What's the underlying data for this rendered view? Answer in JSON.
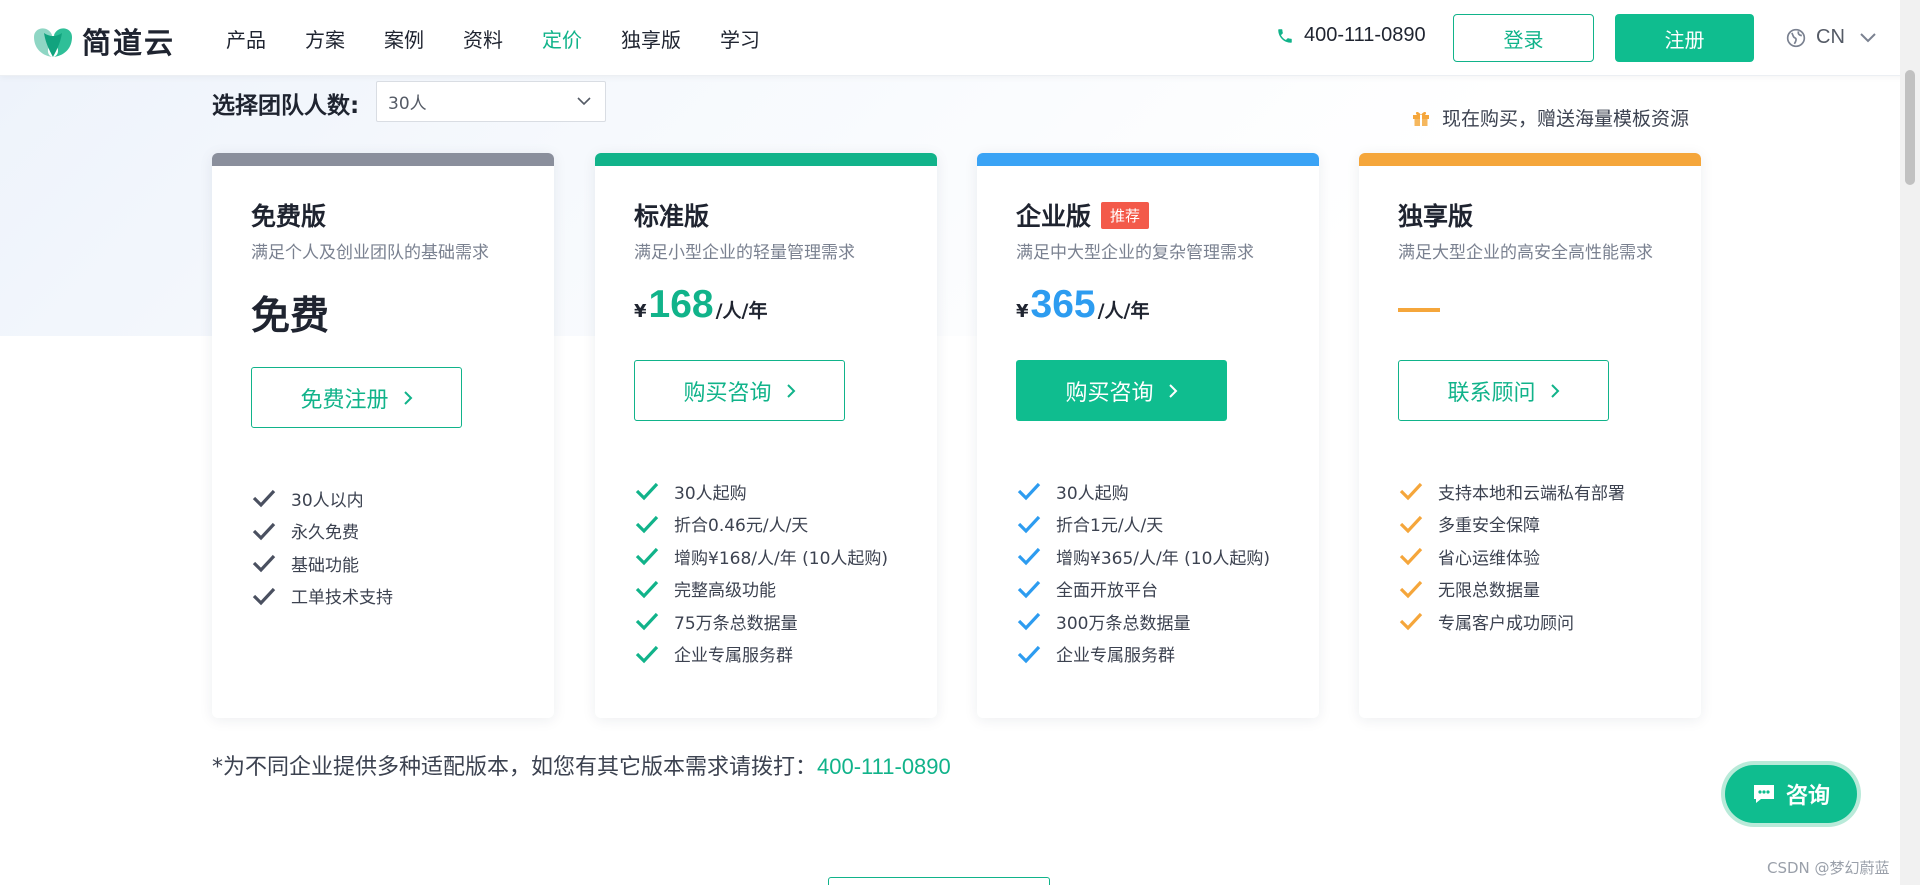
{
  "brand": {
    "name": "简道云",
    "accent": "#11b38a",
    "logo_icon": "heart-leaf-logo-icon"
  },
  "nav": {
    "items": [
      {
        "label": "产品",
        "active": false
      },
      {
        "label": "方案",
        "active": false
      },
      {
        "label": "案例",
        "active": false
      },
      {
        "label": "资料",
        "active": false
      },
      {
        "label": "定价",
        "active": true
      },
      {
        "label": "独享版",
        "active": false
      },
      {
        "label": "学习",
        "active": false
      }
    ],
    "phone": "400-111-0890",
    "login_label": "登录",
    "register_label": "注册",
    "lang": "CN"
  },
  "team": {
    "label": "选择团队人数:",
    "selected": "30人"
  },
  "promo": {
    "text": "现在购买，赠送海量模板资源"
  },
  "plans": [
    {
      "name": "免费版",
      "desc": "满足个人及创业团队的基础需求",
      "price_text": "免费",
      "cta": "免费注册",
      "strip_color": "#8a8f9c",
      "check_color": "#4a5060",
      "features": [
        "30人以内",
        "永久免费",
        "基础功能",
        "工单技术支持"
      ]
    },
    {
      "name": "标准版",
      "desc": "满足小型企业的轻量管理需求",
      "currency": "¥",
      "price": "168",
      "unit": "/人/年",
      "price_color": "#11b38a",
      "cta": "购买咨询",
      "strip_color": "#11b38a",
      "check_color": "#11b38a",
      "features": [
        "30人起购",
        "折合0.46元/人/天",
        "增购¥168/人/年 (10人起购)",
        "完整高级功能",
        "75万条总数据量",
        "企业专属服务群"
      ]
    },
    {
      "name": "企业版",
      "badge": "推荐",
      "desc": "满足中大型企业的复杂管理需求",
      "currency": "¥",
      "price": "365",
      "unit": "/人/年",
      "price_color": "#2d9cf0",
      "cta": "购买咨询",
      "strip_color": "#3aa3f5",
      "check_color": "#2d9cf0",
      "features": [
        "30人起购",
        "折合1元/人/天",
        "增购¥365/人/年 (10人起购)",
        "全面开放平台",
        "300万条总数据量",
        "企业专属服务群"
      ]
    },
    {
      "name": "独享版",
      "desc": "满足大型企业的高安全高性能需求",
      "price_text": "—",
      "cta": "联系顾问",
      "strip_color": "#f5a63b",
      "check_color": "#f5a63b",
      "features": [
        "支持本地和云端私有部署",
        "多重安全保障",
        "省心运维体验",
        "无限总数据量",
        "专属客户成功顾问"
      ]
    }
  ],
  "footnote": {
    "text": "*为不同企业提供多种适配版本，如您有其它版本需求请拨打：",
    "phone": "400-111-0890"
  },
  "consult": {
    "label": "咨询"
  },
  "watermark": "CSDN @梦幻蔚蓝"
}
